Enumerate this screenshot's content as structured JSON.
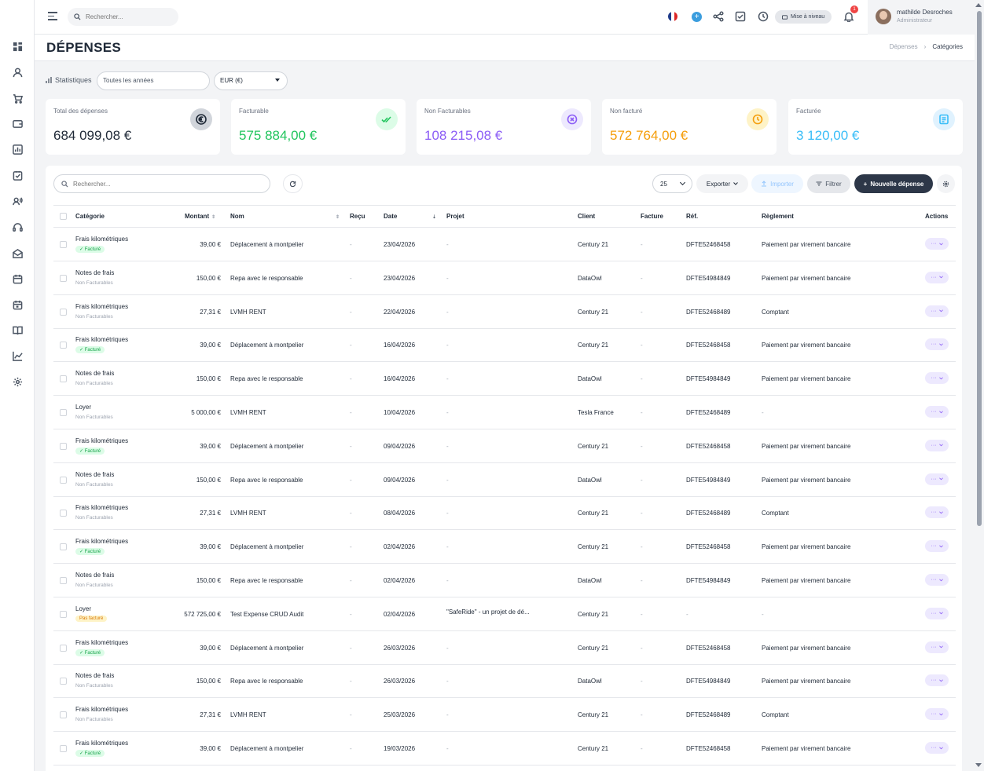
{
  "topbar": {
    "search_placeholder": "Rechercher...",
    "upgrade_label": "Mise à niveau",
    "notif_count": "1",
    "user_name": "mathilde Desroches",
    "user_role": "Administrateur"
  },
  "page": {
    "title": "DÉPENSES",
    "breadcrumb": [
      "Dépenses",
      "›",
      "Catégories"
    ]
  },
  "stats": {
    "label": "Statistiques",
    "year_select": "Toutes les années",
    "currency_select": "EUR (€)"
  },
  "cards": [
    {
      "label": "Total des dépenses",
      "value": "684 099,08 €",
      "color": "#1f2937",
      "icon": "euro-icon"
    },
    {
      "label": "Facturable",
      "value": "575 884,00 €",
      "color": "#22c55e",
      "icon": "double-check-icon"
    },
    {
      "label": "Non Facturables",
      "value": "108 215,08 €",
      "color": "#8b5cf6",
      "icon": "x-circle-icon"
    },
    {
      "label": "Non facturé",
      "value": "572 764,00 €",
      "color": "#f59e0b",
      "icon": "clock-icon"
    },
    {
      "label": "Facturée",
      "value": "3 120,00 €",
      "color": "#38bdf8",
      "icon": "document-icon"
    }
  ],
  "toolbar": {
    "search_placeholder": "Rechercher...",
    "per_page": "25",
    "export_label": "Exporter",
    "import_label": "Importer",
    "filter_label": "Filtrer",
    "new_label": "Nouvelle dépense"
  },
  "columns": {
    "category": "Catégorie",
    "amount": "Montant",
    "name": "Nom",
    "receipt": "Reçu",
    "date": "Date",
    "project": "Projet",
    "client": "Client",
    "invoice": "Facture",
    "ref": "Réf.",
    "payment": "Règlement",
    "actions": "Actions"
  },
  "rows": [
    {
      "category": "Frais kilométriques",
      "status": "Facturé",
      "status_type": "green",
      "amount": "39,00 €",
      "name": "Déplacement à montpelier",
      "receipt": "-",
      "date": "23/04/2026",
      "project": "-",
      "client": "Century 21",
      "invoice": "-",
      "ref": "DFTE52468458",
      "payment": "Paiement par virement bancaire"
    },
    {
      "category": "Notes de frais",
      "status": "Non Facturables",
      "status_type": "plain",
      "amount": "150,00 €",
      "name": "Repa avec le responsable",
      "receipt": "-",
      "date": "23/04/2026",
      "project": "-",
      "client": "DataOwl",
      "invoice": "-",
      "ref": "DFTE54984849",
      "payment": "Paiement par virement bancaire"
    },
    {
      "category": "Frais kilométriques",
      "status": "Non Facturables",
      "status_type": "plain",
      "amount": "27,31 €",
      "name": "LVMH RENT",
      "receipt": "-",
      "date": "22/04/2026",
      "project": "-",
      "client": "Century 21",
      "invoice": "-",
      "ref": "DFTE52468489",
      "payment": "Comptant"
    },
    {
      "category": "Frais kilométriques",
      "status": "Facturé",
      "status_type": "green",
      "amount": "39,00 €",
      "name": "Déplacement à montpelier",
      "receipt": "-",
      "date": "16/04/2026",
      "project": "-",
      "client": "Century 21",
      "invoice": "-",
      "ref": "DFTE52468458",
      "payment": "Paiement par virement bancaire"
    },
    {
      "category": "Notes de frais",
      "status": "Non Facturables",
      "status_type": "plain",
      "amount": "150,00 €",
      "name": "Repa avec le responsable",
      "receipt": "-",
      "date": "16/04/2026",
      "project": "-",
      "client": "DataOwl",
      "invoice": "-",
      "ref": "DFTE54984849",
      "payment": "Paiement par virement bancaire"
    },
    {
      "category": "Loyer",
      "status": "Non Facturables",
      "status_type": "plain",
      "amount": "5 000,00 €",
      "name": "LVMH RENT",
      "receipt": "-",
      "date": "10/04/2026",
      "project": "-",
      "client": "Tesla France",
      "invoice": "-",
      "ref": "DFTE52468489",
      "payment": "-"
    },
    {
      "category": "Frais kilométriques",
      "status": "Facturé",
      "status_type": "green",
      "amount": "39,00 €",
      "name": "Déplacement à montpelier",
      "receipt": "-",
      "date": "09/04/2026",
      "project": "-",
      "client": "Century 21",
      "invoice": "-",
      "ref": "DFTE52468458",
      "payment": "Paiement par virement bancaire"
    },
    {
      "category": "Notes de frais",
      "status": "Non Facturables",
      "status_type": "plain",
      "amount": "150,00 €",
      "name": "Repa avec le responsable",
      "receipt": "-",
      "date": "09/04/2026",
      "project": "-",
      "client": "DataOwl",
      "invoice": "-",
      "ref": "DFTE54984849",
      "payment": "Paiement par virement bancaire"
    },
    {
      "category": "Frais kilométriques",
      "status": "Non Facturables",
      "status_type": "plain",
      "amount": "27,31 €",
      "name": "LVMH RENT",
      "receipt": "-",
      "date": "08/04/2026",
      "project": "-",
      "client": "Century 21",
      "invoice": "-",
      "ref": "DFTE52468489",
      "payment": "Comptant"
    },
    {
      "category": "Frais kilométriques",
      "status": "Facturé",
      "status_type": "green",
      "amount": "39,00 €",
      "name": "Déplacement à montpelier",
      "receipt": "-",
      "date": "02/04/2026",
      "project": "-",
      "client": "Century 21",
      "invoice": "-",
      "ref": "DFTE52468458",
      "payment": "Paiement par virement bancaire"
    },
    {
      "category": "Notes de frais",
      "status": "Non Facturables",
      "status_type": "plain",
      "amount": "150,00 €",
      "name": "Repa avec le responsable",
      "receipt": "-",
      "date": "02/04/2026",
      "project": "-",
      "client": "DataOwl",
      "invoice": "-",
      "ref": "DFTE54984849",
      "payment": "Paiement par virement bancaire"
    },
    {
      "category": "Loyer",
      "status": "Pas facturé",
      "status_type": "orange",
      "amount": "572 725,00 €",
      "name": "Test Expense CRUD Audit",
      "receipt": "-",
      "date": "02/04/2026",
      "project": "\"SafeRide\" - un projet de dé...",
      "client": "Century 21",
      "invoice": "-",
      "ref": "-",
      "payment": "-"
    },
    {
      "category": "Frais kilométriques",
      "status": "Facturé",
      "status_type": "green",
      "amount": "39,00 €",
      "name": "Déplacement à montpelier",
      "receipt": "-",
      "date": "26/03/2026",
      "project": "-",
      "client": "Century 21",
      "invoice": "-",
      "ref": "DFTE52468458",
      "payment": "Paiement par virement bancaire"
    },
    {
      "category": "Notes de frais",
      "status": "Non Facturables",
      "status_type": "plain",
      "amount": "150,00 €",
      "name": "Repa avec le responsable",
      "receipt": "-",
      "date": "26/03/2026",
      "project": "-",
      "client": "DataOwl",
      "invoice": "-",
      "ref": "DFTE54984849",
      "payment": "Paiement par virement bancaire"
    },
    {
      "category": "Frais kilométriques",
      "status": "Non Facturables",
      "status_type": "plain",
      "amount": "27,31 €",
      "name": "LVMH RENT",
      "receipt": "-",
      "date": "25/03/2026",
      "project": "-",
      "client": "Century 21",
      "invoice": "-",
      "ref": "DFTE52468489",
      "payment": "Comptant"
    },
    {
      "category": "Frais kilométriques",
      "status": "Facturé",
      "status_type": "green",
      "amount": "39,00 €",
      "name": "Déplacement à montpelier",
      "receipt": "-",
      "date": "19/03/2026",
      "project": "-",
      "client": "Century 21",
      "invoice": "-",
      "ref": "DFTE52468458",
      "payment": "Paiement par virement bancaire"
    }
  ],
  "row_action_label": "···"
}
